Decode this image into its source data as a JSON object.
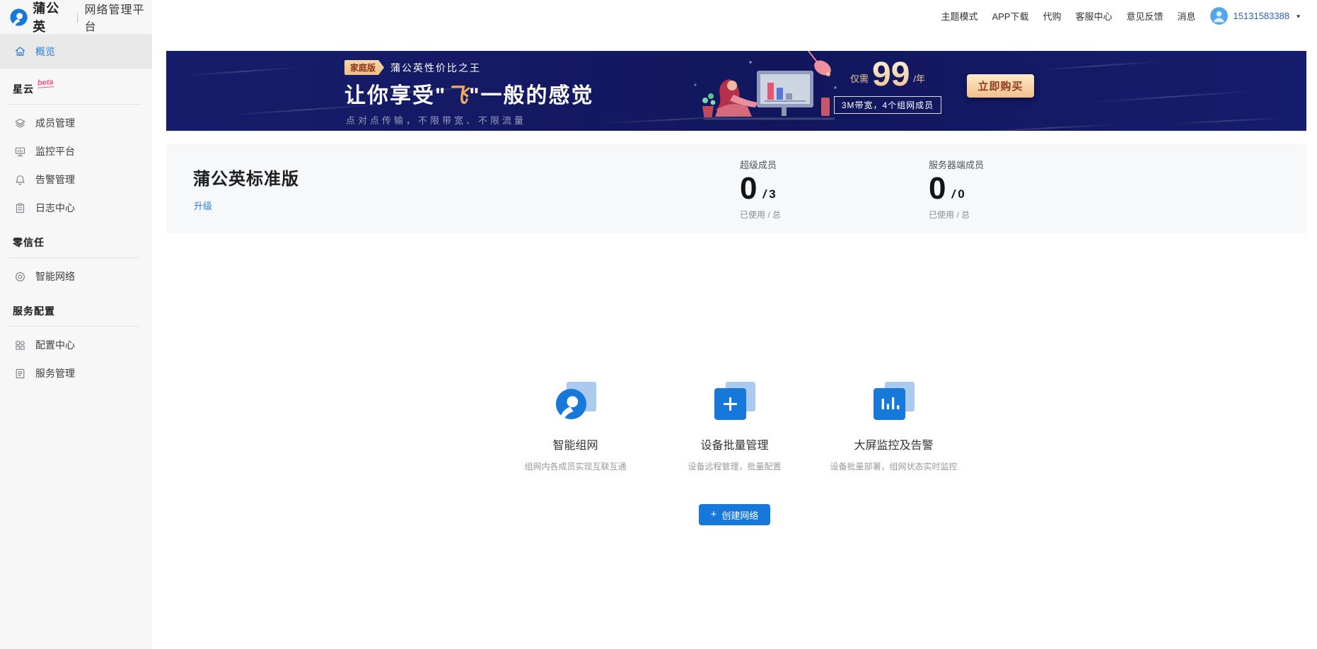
{
  "colors": {
    "primary_blue": "#1677dc",
    "banner_navy": "#141b63",
    "banner_tan": "#f2cd9e",
    "badge_maroon": "#93391c",
    "link_blue": "#2a7ce0",
    "beta_pink": "#f5557d",
    "sidebar_active_bg": "#e9e9e9"
  },
  "header": {
    "logo_text": "蒲公英",
    "logo_divider": "|",
    "logo_subtitle": "网络管理平台",
    "nav_items": [
      "主题模式",
      "APP下载",
      "代购",
      "客服中心",
      "意见反馈",
      "消息"
    ],
    "username": "15131583388",
    "icons": {
      "caret_down": "▼"
    }
  },
  "sidebar": {
    "overview": {
      "label": "概览",
      "icon": "home-icon"
    },
    "sections": [
      {
        "title": "星云",
        "badge": "beta",
        "items": [
          {
            "label": "成员管理",
            "icon": "layers-icon"
          },
          {
            "label": "监控平台",
            "icon": "monitor-icon"
          },
          {
            "label": "告警管理",
            "icon": "bell-icon"
          },
          {
            "label": "日志中心",
            "icon": "clipboard-icon"
          }
        ]
      },
      {
        "title": "零信任",
        "badge": "",
        "items": [
          {
            "label": "智能网络",
            "icon": "target-icon"
          }
        ]
      },
      {
        "title": "服务配置",
        "badge": "",
        "items": [
          {
            "label": "配置中心",
            "icon": "grid-icon"
          },
          {
            "label": "服务管理",
            "icon": "document-icon"
          }
        ]
      }
    ]
  },
  "banner": {
    "badge": "家庭版",
    "tagline": "蒲公英性价比之王",
    "title_pre": "让你享受\"",
    "title_highlight": "飞",
    "title_post": "\"一般的感觉",
    "subtitle": "点对点传输，不限带宽、不限流量",
    "price_prefix": "仅需",
    "price": "99",
    "price_unit": "/年",
    "spec": "3M带宽，4个组网成员",
    "buy_button": "立即购买"
  },
  "plan": {
    "title": "蒲公英标准版",
    "upgrade_link": "升级",
    "value_separator": "/",
    "stats": [
      {
        "label": "超级成员",
        "used": "0",
        "total": "3",
        "caption": "已使用 / 总"
      },
      {
        "label": "服务器端成员",
        "used": "0",
        "total": "0",
        "caption": "已使用 / 总"
      }
    ]
  },
  "features": [
    {
      "title": "智能组网",
      "desc": "组网内各成员实现互联互通",
      "icon": "dandelion-network-icon"
    },
    {
      "title": "设备批量管理",
      "desc": "设备远程管理，批量配置",
      "icon": "batch-add-icon"
    },
    {
      "title": "大屏监控及告警",
      "desc": "设备批量部署，组网状态实时监控",
      "icon": "dashboard-chart-icon"
    }
  ],
  "create_network": {
    "plus": "+",
    "label": "创建网络"
  }
}
